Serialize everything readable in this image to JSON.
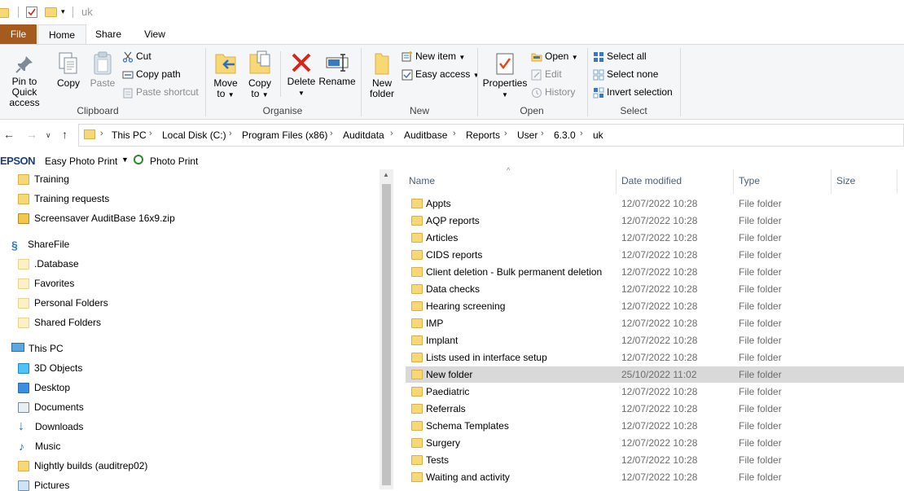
{
  "window": {
    "title": "uk"
  },
  "tabs": {
    "file": "File",
    "home": "Home",
    "share": "Share",
    "view": "View"
  },
  "ribbon": {
    "clipboard": {
      "label": "Clipboard",
      "pin_line1": "Pin to Quick",
      "pin_line2": "access",
      "copy": "Copy",
      "paste": "Paste",
      "cut": "Cut",
      "copy_path": "Copy path",
      "paste_shortcut": "Paste shortcut"
    },
    "organise": {
      "label": "Organise",
      "move_line1": "Move",
      "move_line2": "to",
      "copy_line1": "Copy",
      "copy_line2": "to",
      "delete": "Delete",
      "rename": "Rename"
    },
    "new": {
      "label": "New",
      "folder_line1": "New",
      "folder_line2": "folder",
      "new_item": "New item",
      "easy_access": "Easy access"
    },
    "open": {
      "label": "Open",
      "properties": "Properties",
      "open": "Open",
      "edit": "Edit",
      "history": "History"
    },
    "select": {
      "label": "Select",
      "select_all": "Select all",
      "select_none": "Select none",
      "invert": "Invert selection"
    }
  },
  "breadcrumb": [
    "This PC",
    "Local Disk (C:)",
    "Program Files (x86)",
    "Auditdata",
    "Auditbase",
    "Reports",
    "User",
    "6.3.0",
    "uk"
  ],
  "toolbar": {
    "epson": "EPSON",
    "easy_photo_print": "Easy Photo Print",
    "photo_print": "Photo Print"
  },
  "nav": {
    "training": "Training",
    "training_requests": "Training requests",
    "screensaver": "Screensaver AuditBase 16x9.zip",
    "sharefile": "ShareFile",
    "database": ".Database",
    "favorites": "Favorites",
    "personal": "Personal Folders",
    "shared": "Shared Folders",
    "thispc": "This PC",
    "objects3d": "3D Objects",
    "desktop": "Desktop",
    "documents": "Documents",
    "downloads": "Downloads",
    "music": "Music",
    "nightly": "Nightly builds (auditrep02)",
    "pictures": "Pictures"
  },
  "columns": {
    "name": "Name",
    "date": "Date modified",
    "type": "Type",
    "size": "Size"
  },
  "files": [
    {
      "name": "Appts",
      "date": "12/07/2022 10:28",
      "type": "File folder"
    },
    {
      "name": "AQP reports",
      "date": "12/07/2022 10:28",
      "type": "File folder"
    },
    {
      "name": "Articles",
      "date": "12/07/2022 10:28",
      "type": "File folder"
    },
    {
      "name": "CIDS reports",
      "date": "12/07/2022 10:28",
      "type": "File folder"
    },
    {
      "name": "Client deletion - Bulk permanent deletion",
      "date": "12/07/2022 10:28",
      "type": "File folder"
    },
    {
      "name": "Data checks",
      "date": "12/07/2022 10:28",
      "type": "File folder"
    },
    {
      "name": "Hearing screening",
      "date": "12/07/2022 10:28",
      "type": "File folder"
    },
    {
      "name": "IMP",
      "date": "12/07/2022 10:28",
      "type": "File folder"
    },
    {
      "name": "Implant",
      "date": "12/07/2022 10:28",
      "type": "File folder"
    },
    {
      "name": "Lists used in interface setup",
      "date": "12/07/2022 10:28",
      "type": "File folder"
    },
    {
      "name": "New folder",
      "date": "25/10/2022 11:02",
      "type": "File folder"
    },
    {
      "name": "Paediatric",
      "date": "12/07/2022 10:28",
      "type": "File folder"
    },
    {
      "name": "Referrals",
      "date": "12/07/2022 10:28",
      "type": "File folder"
    },
    {
      "name": "Schema Templates",
      "date": "12/07/2022 10:28",
      "type": "File folder"
    },
    {
      "name": "Surgery",
      "date": "12/07/2022 10:28",
      "type": "File folder"
    },
    {
      "name": "Tests",
      "date": "12/07/2022 10:28",
      "type": "File folder"
    },
    {
      "name": "Waiting and activity",
      "date": "12/07/2022 10:28",
      "type": "File folder"
    }
  ]
}
